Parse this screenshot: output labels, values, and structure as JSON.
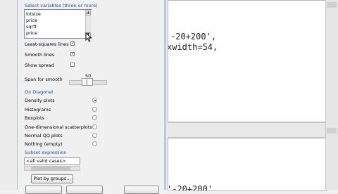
{
  "dialog": {
    "select_variables_label": "Select variables (three or more)",
    "variables": [
      "lotsize",
      "price",
      "sqrft",
      "price"
    ],
    "least_squares_label": "Least-squares lines",
    "least_squares_checked": true,
    "smooth_lines_label": "Smooth lines",
    "smooth_lines_checked": true,
    "show_spread_label": "Show spread",
    "show_spread_checked": false,
    "span_label": "Span for smooth",
    "span_value": "50",
    "on_diagonal_label": "On Diagonal",
    "diagonal_options": [
      "Density plots",
      "Histograms",
      "Boxplots",
      "One-dimensional scatterplots",
      "Normal QQ plots",
      "Nothing (empty)"
    ],
    "diagonal_selected": 0,
    "subset_label": "Subset expression",
    "subset_value": "<all valid cases>",
    "plot_by_groups_label": "Plot by groups..."
  },
  "script": {
    "line1": "-20+200',",
    "line2": "xwidth=54,"
  },
  "output": {
    "line1": "'-20+200',"
  },
  "colors": {
    "section_blue": "#1f4fa8",
    "dialog_border": "#b9c9de"
  }
}
